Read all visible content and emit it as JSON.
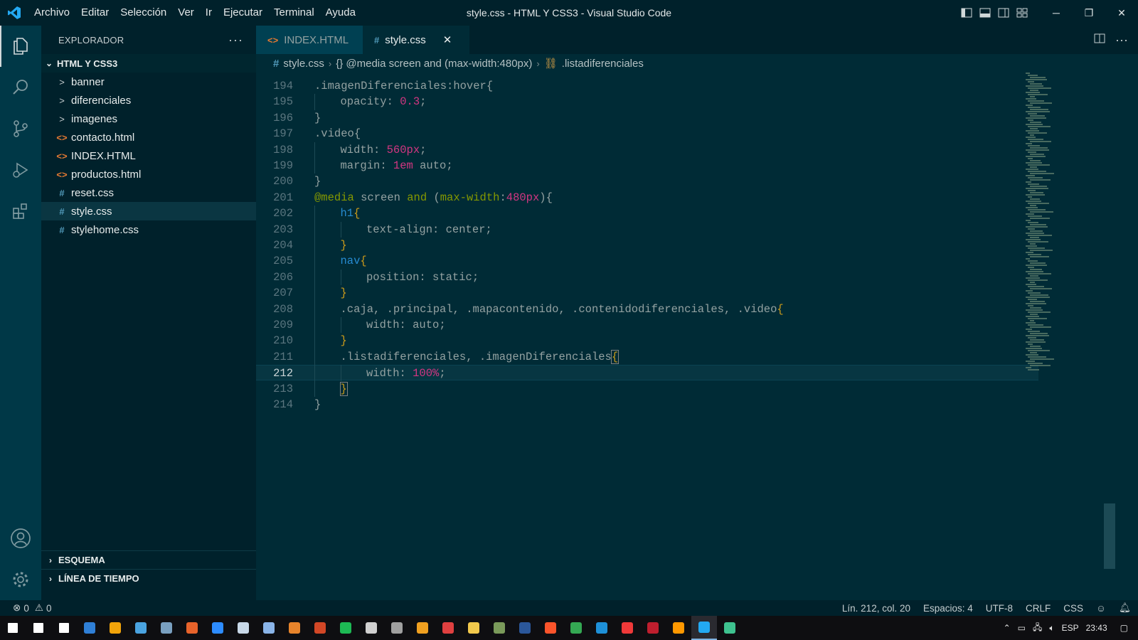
{
  "window": {
    "title": "style.css - HTML Y CSS3 - Visual Studio Code"
  },
  "menu": [
    "Archivo",
    "Editar",
    "Selección",
    "Ver",
    "Ir",
    "Ejecutar",
    "Terminal",
    "Ayuda"
  ],
  "activity": [
    "explorer-icon",
    "search-icon",
    "source-control-icon",
    "run-debug-icon",
    "extensions-icon",
    "account-icon",
    "gear-icon"
  ],
  "sidebar": {
    "header": "EXPLORADOR",
    "more": "···",
    "root": "HTML Y CSS3",
    "items": [
      {
        "label": "banner",
        "type": "folder",
        "icon": ">"
      },
      {
        "label": "diferenciales",
        "type": "folder",
        "icon": ">"
      },
      {
        "label": "imagenes",
        "type": "folder",
        "icon": ">"
      },
      {
        "label": "contacto.html",
        "type": "html",
        "icon": "<>"
      },
      {
        "label": "INDEX.HTML",
        "type": "html",
        "icon": "<>"
      },
      {
        "label": "productos.html",
        "type": "html",
        "icon": "<>"
      },
      {
        "label": "reset.css",
        "type": "css",
        "icon": "#"
      },
      {
        "label": "style.css",
        "type": "css",
        "icon": "#"
      },
      {
        "label": "stylehome.css",
        "type": "css",
        "icon": "#"
      }
    ],
    "sections": [
      "ESQUEMA",
      "LÍNEA DE TIEMPO"
    ]
  },
  "tabs": [
    {
      "label": "INDEX.HTML",
      "icon": "<>"
    },
    {
      "label": "style.css",
      "icon": "#",
      "close": "✕"
    }
  ],
  "breadcrumb": {
    "file": "style.css",
    "media": "{} @media screen and (max-width:480px)",
    "symbol": ".listadiferenciales"
  },
  "code": {
    "current_line": 212,
    "lines": [
      {
        "n": 194,
        "indent": 0,
        "tokens": [
          {
            "t": ".imagenDiferenciales:hover",
            "c": "t-sel"
          },
          {
            "t": "{",
            "c": "t-sel"
          }
        ]
      },
      {
        "n": 195,
        "indent": 1,
        "tokens": [
          {
            "t": "opacity",
            "c": "t-prop"
          },
          {
            "t": ": ",
            "c": "t-prop"
          },
          {
            "t": "0.3",
            "c": "t-num"
          },
          {
            "t": ";",
            "c": "t-prop"
          }
        ]
      },
      {
        "n": 196,
        "indent": 0,
        "tokens": [
          {
            "t": "}",
            "c": "t-sel"
          }
        ]
      },
      {
        "n": 197,
        "indent": 0,
        "tokens": [
          {
            "t": ".video",
            "c": "t-sel"
          },
          {
            "t": "{",
            "c": "t-sel"
          }
        ]
      },
      {
        "n": 198,
        "indent": 1,
        "tokens": [
          {
            "t": "width",
            "c": "t-prop"
          },
          {
            "t": ": ",
            "c": "t-prop"
          },
          {
            "t": "560px",
            "c": "t-num"
          },
          {
            "t": ";",
            "c": "t-prop"
          }
        ]
      },
      {
        "n": 199,
        "indent": 1,
        "tokens": [
          {
            "t": "margin",
            "c": "t-prop"
          },
          {
            "t": ": ",
            "c": "t-prop"
          },
          {
            "t": "1em",
            "c": "t-num"
          },
          {
            "t": " auto;",
            "c": "t-prop"
          }
        ]
      },
      {
        "n": 200,
        "indent": 0,
        "tokens": [
          {
            "t": "}",
            "c": "t-sel"
          }
        ]
      },
      {
        "n": 201,
        "indent": 0,
        "tokens": [
          {
            "t": "@media",
            "c": "t-kw"
          },
          {
            "t": " screen ",
            "c": "t-sel"
          },
          {
            "t": "and",
            "c": "t-kw"
          },
          {
            "t": " (",
            "c": "t-sel"
          },
          {
            "t": "max-width",
            "c": "t-kw"
          },
          {
            "t": ":",
            "c": "t-sel"
          },
          {
            "t": "480px",
            "c": "t-num"
          },
          {
            "t": "){",
            "c": "t-sel"
          }
        ]
      },
      {
        "n": 202,
        "indent": 1,
        "tokens": [
          {
            "t": "h1",
            "c": "t-tag"
          },
          {
            "t": "{",
            "c": "t-brace"
          }
        ]
      },
      {
        "n": 203,
        "indent": 2,
        "tokens": [
          {
            "t": "text-align",
            "c": "t-prop"
          },
          {
            "t": ": center;",
            "c": "t-prop"
          }
        ]
      },
      {
        "n": 204,
        "indent": 1,
        "tokens": [
          {
            "t": "}",
            "c": "t-brace"
          }
        ]
      },
      {
        "n": 205,
        "indent": 1,
        "tokens": [
          {
            "t": "nav",
            "c": "t-tag"
          },
          {
            "t": "{",
            "c": "t-brace"
          }
        ]
      },
      {
        "n": 206,
        "indent": 2,
        "tokens": [
          {
            "t": "position",
            "c": "t-prop"
          },
          {
            "t": ": static;",
            "c": "t-prop"
          }
        ]
      },
      {
        "n": 207,
        "indent": 1,
        "tokens": [
          {
            "t": "}",
            "c": "t-brace"
          }
        ]
      },
      {
        "n": 208,
        "indent": 1,
        "tokens": [
          {
            "t": ".caja, .principal, .mapacontenido, .contenidodiferenciales, .video",
            "c": "t-sel"
          },
          {
            "t": "{",
            "c": "t-brace"
          }
        ]
      },
      {
        "n": 209,
        "indent": 2,
        "tokens": [
          {
            "t": "width",
            "c": "t-prop"
          },
          {
            "t": ": auto;",
            "c": "t-prop"
          }
        ]
      },
      {
        "n": 210,
        "indent": 1,
        "tokens": [
          {
            "t": "}",
            "c": "t-brace"
          }
        ]
      },
      {
        "n": 211,
        "indent": 1,
        "tokens": [
          {
            "t": ".listadiferenciales, .imagenDiferenciales",
            "c": "t-sel"
          },
          {
            "t": "{",
            "c": "t-brace-m"
          }
        ]
      },
      {
        "n": 212,
        "indent": 2,
        "tokens": [
          {
            "t": "width",
            "c": "t-prop"
          },
          {
            "t": ": ",
            "c": "t-prop"
          },
          {
            "t": "100%",
            "c": "t-num"
          },
          {
            "t": ";",
            "c": "t-prop"
          }
        ]
      },
      {
        "n": 213,
        "indent": 1,
        "tokens": [
          {
            "t": "}",
            "c": "t-brace-m"
          }
        ]
      },
      {
        "n": 214,
        "indent": 0,
        "tokens": [
          {
            "t": "}",
            "c": "t-sel"
          }
        ]
      }
    ]
  },
  "status": {
    "errors": "0",
    "warnings": "0",
    "position": "Lín. 212, col. 20",
    "spaces": "Espacios: 4",
    "encoding": "UTF-8",
    "eol": "CRLF",
    "language": "CSS"
  },
  "taskbar": {
    "apps": [
      {
        "name": "start-icon",
        "color": "#ffffff"
      },
      {
        "name": "search-icon",
        "color": "#ffffff"
      },
      {
        "name": "task-view-icon",
        "color": "#ffffff"
      },
      {
        "name": "mail-icon",
        "color": "#2f7fd6"
      },
      {
        "name": "store-icon",
        "color": "#f2a40a"
      },
      {
        "name": "magnifier-app-icon",
        "color": "#4aa3e0"
      },
      {
        "name": "photos-icon",
        "color": "#7aa0c0"
      },
      {
        "name": "firefox-icon",
        "color": "#e8632b"
      },
      {
        "name": "zoom-icon",
        "color": "#2d8cff"
      },
      {
        "name": "settings-app-icon",
        "color": "#c8d8e8"
      },
      {
        "name": "notes-icon",
        "color": "#8ab4e8"
      },
      {
        "name": "blender-icon",
        "color": "#e8842b"
      },
      {
        "name": "powerpoint-icon",
        "color": "#d24726"
      },
      {
        "name": "spotify-icon",
        "color": "#1db954"
      },
      {
        "name": "obs-icon",
        "color": "#d0d0d0"
      },
      {
        "name": "calculator-icon",
        "color": "#a0a0a0"
      },
      {
        "name": "video-player-icon",
        "color": "#f0a020"
      },
      {
        "name": "paint-icon",
        "color": "#e04040"
      },
      {
        "name": "file-explorer-icon",
        "color": "#f2c94c"
      },
      {
        "name": "app-icon",
        "color": "#7a9a5a"
      },
      {
        "name": "word-icon",
        "color": "#2b579a"
      },
      {
        "name": "brave-icon",
        "color": "#fb542b"
      },
      {
        "name": "chrome-icon",
        "color": "#34a853"
      },
      {
        "name": "edge-icon",
        "color": "#1e90d8"
      },
      {
        "name": "vivaldi-icon",
        "color": "#ef3939"
      },
      {
        "name": "filezilla-icon",
        "color": "#bf1e2e"
      },
      {
        "name": "sublime-icon",
        "color": "#ff9800"
      },
      {
        "name": "vscode-icon",
        "color": "#23a9f2"
      },
      {
        "name": "app2-icon",
        "color": "#3ec28f"
      }
    ],
    "lang": "ESP",
    "time": "23:43"
  }
}
